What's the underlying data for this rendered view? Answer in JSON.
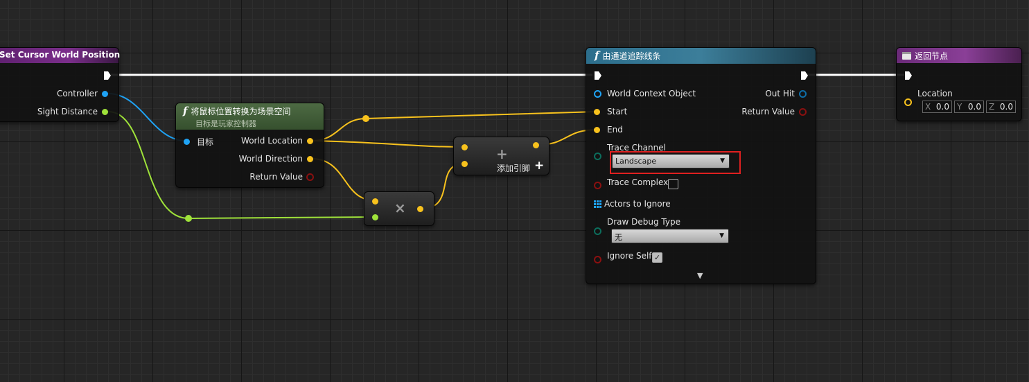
{
  "node_set_cursor": {
    "title": "Set Cursor World Position",
    "pins": [
      "Controller",
      "Sight Distance"
    ]
  },
  "node_convert": {
    "title": "将鼠标位置转换为场景空间",
    "subtitle": "目标是玩家控制器",
    "target_label": "目标",
    "outputs": [
      "World Location",
      "World Direction",
      "Return Value"
    ]
  },
  "node_multiply": {
    "symbol": "×"
  },
  "node_add": {
    "symbol": "+",
    "add_pin_label": "添加引脚",
    "add_pin_icon": "+"
  },
  "node_trace": {
    "title": "由通道追踪线条",
    "inputs": [
      "World Context Object",
      "Start",
      "End"
    ],
    "outputs": [
      "Out Hit",
      "Return Value"
    ],
    "trace_channel_label": "Trace Channel",
    "trace_channel_value": "Landscape",
    "trace_complex_label": "Trace Complex",
    "actors_to_ignore_label": "Actors to Ignore",
    "draw_debug_label": "Draw Debug Type",
    "draw_debug_value": "无",
    "ignore_self_label": "Ignore Self",
    "ignore_self_checked": "✓",
    "expand_icon": "▼"
  },
  "node_return": {
    "title": "返回节点",
    "location_label": "Location",
    "x_label": "X",
    "y_label": "Y",
    "z_label": "Z",
    "x": "0.0",
    "y": "0.0",
    "z": "0.0"
  },
  "colors": {
    "exec": "#ffffff",
    "object": "#1fa3f5",
    "float": "#9fe23a",
    "vector": "#f8c21d",
    "struct": "#0e6ea8",
    "bool": "#8a1010",
    "byte": "#0c6d5c",
    "highlight": "#e02020"
  }
}
